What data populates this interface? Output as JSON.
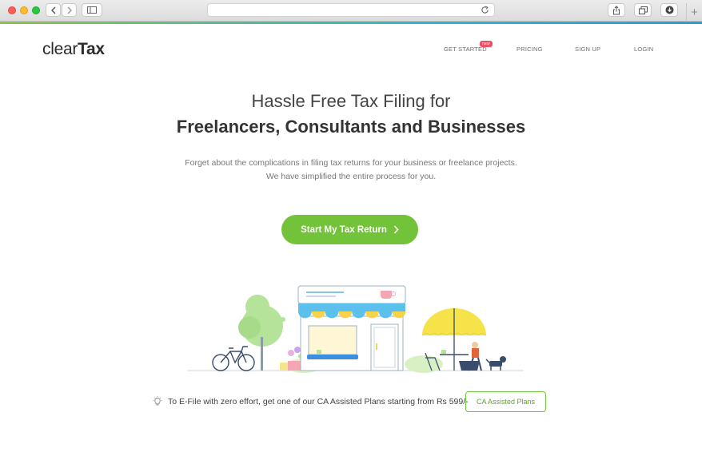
{
  "browser": {
    "icons": [
      "back-icon",
      "forward-icon",
      "sidebar-icon",
      "reload-icon",
      "share-icon",
      "tabs-icon",
      "download-icon",
      "new-tab-icon"
    ]
  },
  "header": {
    "logo_light": "clear",
    "logo_bold": "Tax",
    "nav": {
      "get_started": "GET STARTED",
      "new_badge": "new",
      "pricing": "PRICING",
      "sign_up": "SIGN UP",
      "login": "LOGIN"
    }
  },
  "hero": {
    "title_line1": "Hassle Free Tax Filing for",
    "title_line2": "Freelancers, Consultants and Businesses",
    "subtitle_line1": "Forget about the complications in filing tax returns for your business or freelance projects.",
    "subtitle_line2": "We have simplified the entire process for you.",
    "cta_label": "Start My Tax Return"
  },
  "tip": {
    "text": "To E-File with zero effort, get one of our CA Assisted Plans starting from Rs 599/-",
    "button_label": "CA Assisted Plans"
  },
  "colors": {
    "accent_green": "#72c23a",
    "accent_blue": "#2b9bd6",
    "badge_red": "#f04e64"
  }
}
